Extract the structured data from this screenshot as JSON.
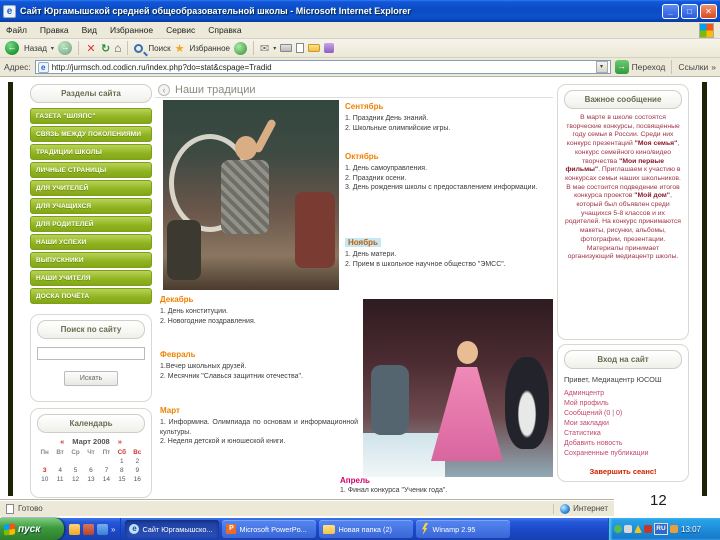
{
  "icons": {
    "back": "←",
    "forward": "→",
    "stop": "✕",
    "refresh": "↻",
    "home": "⌂",
    "star": "★",
    "mail": "✉",
    "dropdown": "▾",
    "links_chevron": "»",
    "go_arrow": "→",
    "minimize": "_",
    "restore": "□",
    "close": "✕",
    "title_back": "‹",
    "ie_glyph": "e",
    "ppt_glyph": "P",
    "overflow": "»"
  },
  "window": {
    "title": "Сайт Юргамышской средней общеобразовательной школы - Microsoft Internet Explorer"
  },
  "menu": {
    "items": [
      "Файл",
      "Правка",
      "Вид",
      "Избранное",
      "Сервис",
      "Справка"
    ]
  },
  "toolbar": {
    "back_label": "Назад",
    "search_label": "Поиск",
    "favorites_label": "Избранное"
  },
  "address": {
    "label": "Адрес:",
    "url": "http://jurmsch.od.codicn.ru/index.php?do=stat&cspage=Tradid",
    "go_label": "Переход",
    "links_label": "Ссылки"
  },
  "sidebar": {
    "sections_title": "Разделы сайта",
    "items": [
      "ГАЗЕТА \"ШЛЯПС\"",
      "СВЯЗЬ МЕЖДУ ПОКОЛЕНИЯМИ",
      "ТРАДИЦИИ ШКОЛЫ",
      "ЛИЧНЫЕ СТРАНИЦЫ",
      "ДЛЯ УЧИТЕЛЕЙ",
      "ДЛЯ УЧАЩИХСЯ",
      "ДЛЯ РОДИТЕЛЕЙ",
      "НАШИ УСПЕХИ",
      "ВЫПУСКНИКИ",
      "НАШИ УЧИТЕЛЯ",
      "ДОСКА ПОЧЁТА"
    ],
    "search": {
      "title": "Поиск по сайту",
      "button": "Искать"
    },
    "calendar": {
      "title": "Календарь",
      "prev": "«",
      "next": "»",
      "month": "Март 2008",
      "days": [
        "Пн",
        "Вт",
        "Ср",
        "Чт",
        "Пт",
        "Сб",
        "Вс"
      ],
      "cells": [
        "",
        "",
        "",
        "",
        "",
        "1",
        "2",
        "3",
        "4",
        "5",
        "6",
        "7",
        "8",
        "9",
        "10",
        "11",
        "12",
        "13",
        "14",
        "15",
        "16"
      ]
    }
  },
  "main": {
    "title": "Наши традиции",
    "months": {
      "sep": {
        "title": "Сентябрь",
        "items": [
          "1. Праздник День знаний.",
          "2. Школьные олимпийские игры."
        ]
      },
      "oct": {
        "title": "Октябрь",
        "items": [
          "1. День самоуправления.",
          "2. Праздник осени.",
          "3. День рождения школы с предоставлением информации."
        ]
      },
      "nov": {
        "title": "Ноябрь",
        "items": [
          "1. День матери.",
          "2. Прием в школьное научное общество \"ЭМСС\"."
        ]
      },
      "dec": {
        "title": "Декабрь",
        "items": [
          "1. День конституции.",
          "2. Новогодние поздравления."
        ]
      },
      "feb": {
        "title": "Февраль",
        "items": [
          "1.Вечер школьных друзей.",
          "2. Месячник \"Славься защитник отечества\"."
        ]
      },
      "mar": {
        "title": "Март",
        "items": [
          "1. Информина. Олимпиада по основам и информационной культуры.",
          "2. Неделя детской и юношеской книги."
        ]
      },
      "apr": {
        "title": "Апрель",
        "items": [
          "1. Финал конкурса \"Ученик года\"."
        ]
      }
    }
  },
  "right": {
    "important_title": "Важное сообщение",
    "message": {
      "p1": "В марте в школе состоятся творческие конкурсы, посвященные году семьи в России. Среди них конкурс презентаций ",
      "b1": "\"Моя семья\"",
      "p2": ", конкурс семейного кино/видео творчества ",
      "b2": "\"Мои первые фильмы\"",
      "p3": ". Приглашаем к участию в конкурсах семьи наших школьников. В мае состоится подведение итогов конкурса проектов ",
      "b3": "\"Мой дом\"",
      "p4": ", который был объявлен среди учащихся 5-8 классов и их родителей. На конкурс принимаются макеты, рисунки, альбомы, фотографии, презентации. Материалы принимает организующий медиацентр школы."
    },
    "login": {
      "title": "Вход на сайт",
      "greeting": "Привет, Медиацентр ЮСОШ",
      "links": [
        "Админцентр",
        "Мой профиль",
        "Сообщений (0 | 0)",
        "Мои закладки",
        "Статистика",
        "Добавить новость",
        "Сохраненные публикации"
      ],
      "logout": "Завершить сеанс!"
    }
  },
  "status": {
    "ready": "Готово",
    "zone": "Интернет"
  },
  "slide_number": "12",
  "taskbar": {
    "start": "пуск",
    "tasks": [
      {
        "label": "Сайт Юргамышско..."
      },
      {
        "label": "Microsoft PowerPo..."
      },
      {
        "label": "Новая папка (2)"
      },
      {
        "label": "Winamp 2.95"
      }
    ],
    "tray": {
      "lang": "RU",
      "clock": "13:07"
    }
  }
}
